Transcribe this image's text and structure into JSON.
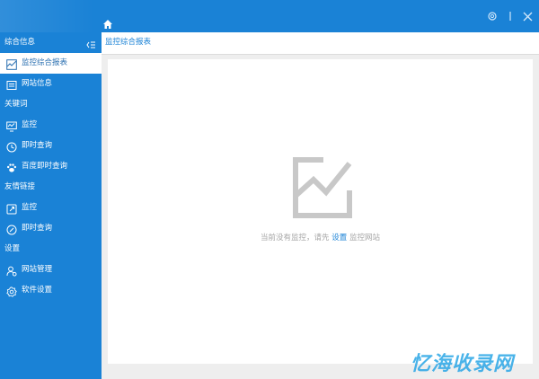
{
  "window": {
    "controls": [
      {
        "name": "settings-icon"
      },
      {
        "name": "minimize-icon"
      },
      {
        "name": "close-icon"
      }
    ],
    "home_icon": "home-icon"
  },
  "sidebar": {
    "sections": [
      {
        "header": "综合信息",
        "collapsible": true,
        "items": [
          {
            "label": "监控综合报表",
            "icon": "chart-icon",
            "active": true
          },
          {
            "label": "网站信息",
            "icon": "id-card-icon",
            "active": false
          }
        ]
      },
      {
        "header": "关键词",
        "items": [
          {
            "label": "监控",
            "icon": "monitor-icon",
            "active": false
          },
          {
            "label": "即时查询",
            "icon": "clock-icon",
            "active": false
          },
          {
            "label": "百度即时查询",
            "icon": "paw-icon",
            "active": false
          }
        ]
      },
      {
        "header": "友情链接",
        "items": [
          {
            "label": "监控",
            "icon": "link-icon",
            "active": false
          },
          {
            "label": "即时查询",
            "icon": "compass-icon",
            "active": false
          }
        ]
      },
      {
        "header": "设置",
        "items": [
          {
            "label": "网站管理",
            "icon": "user-gear-icon",
            "active": false
          },
          {
            "label": "软件设置",
            "icon": "gear-icon",
            "active": false
          }
        ]
      }
    ]
  },
  "main": {
    "title": "监控综合报表",
    "empty_state": {
      "icon": "empty-chart-icon",
      "text_before": "当前没有监控，请先",
      "link_text": "设置",
      "text_after": "监控网站"
    }
  },
  "watermark": {
    "text": "忆海收录网"
  },
  "colors": {
    "accent": "#1a82d6",
    "empty_icon": "#c8c8c8",
    "muted_text": "#a6a6a6"
  }
}
